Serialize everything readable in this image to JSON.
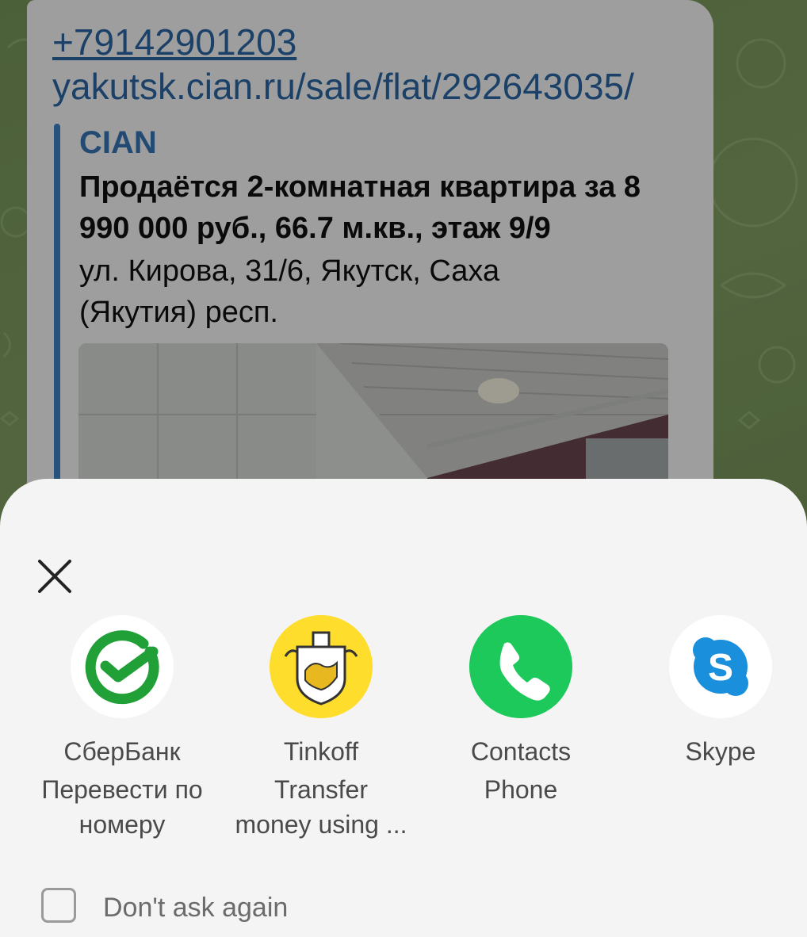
{
  "message": {
    "phone": "+79142901203",
    "url": "yakutsk.cian.ru/sale/flat/292643035/",
    "preview": {
      "site_name": "CIAN",
      "title": "Продаётся 2-комнатная квартира за 8 990 000 руб., 66.7 м.кв., этаж 9/9",
      "description": "ул. Кирова, 31/6, Якутск, Саха (Якутия) респ."
    }
  },
  "chooser": {
    "apps": [
      {
        "icon": "sberbank-icon",
        "label_line1": "СберБанк",
        "label_line2": "Перевести по",
        "label_line3": "номеру"
      },
      {
        "icon": "tinkoff-icon",
        "label_line1": "Tinkoff",
        "label_line2": "Transfer",
        "label_line3": "money using ..."
      },
      {
        "icon": "phone-icon",
        "label_line1": "Contacts",
        "label_line2": "Phone",
        "label_line3": ""
      },
      {
        "icon": "skype-icon",
        "label_line1": "Skype",
        "label_line2": "",
        "label_line3": ""
      }
    ],
    "dont_ask_label": "Don't ask again",
    "dont_ask_checked": false
  },
  "colors": {
    "link": "#2c6aa8",
    "sber_green": "#21a038",
    "tinkoff_yellow": "#ffdd2d",
    "phone_green": "#1ec95b",
    "skype_blue": "#1a8fdc"
  }
}
